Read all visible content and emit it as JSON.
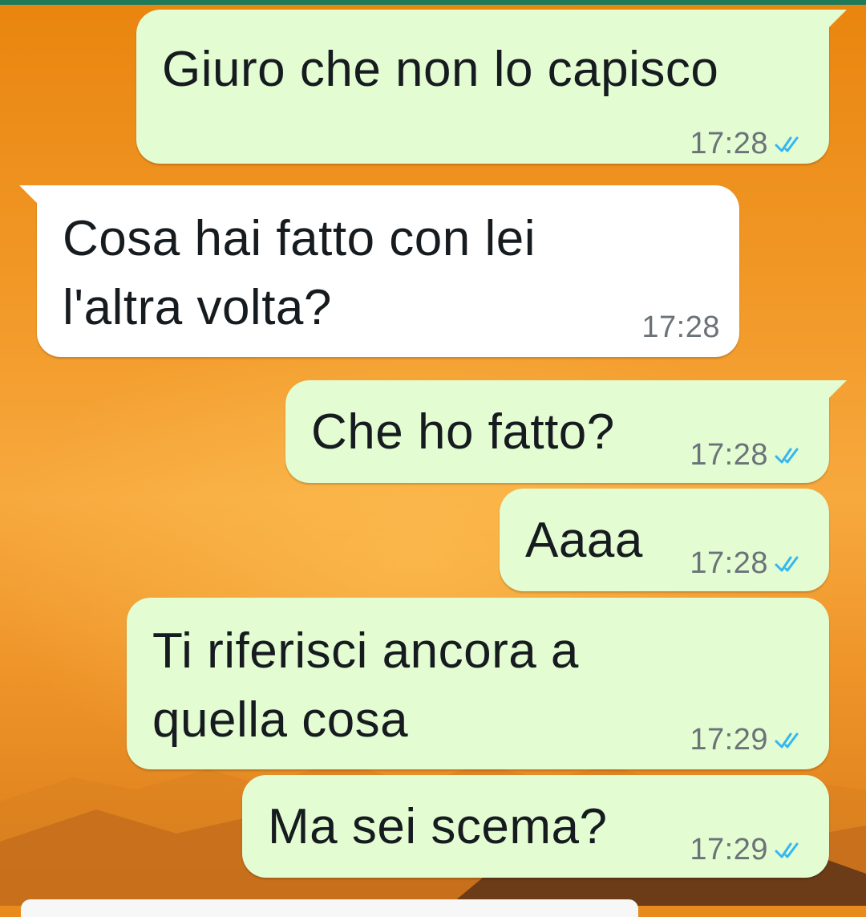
{
  "colors": {
    "outgoing_bubble": "#e3fcd2",
    "incoming_bubble": "#ffffff",
    "read_ticks": "#34b7f1",
    "wallpaper": "#e98a1c"
  },
  "icons": {
    "read_status": "double-check-icon"
  },
  "messages": [
    {
      "direction": "out",
      "text_lines": [
        "Giuro che non lo capisco"
      ],
      "time": "17:28",
      "read": true
    },
    {
      "direction": "in",
      "text_lines": [
        "Cosa hai fatto con lei",
        "l'altra volta?"
      ],
      "time": "17:28"
    },
    {
      "direction": "out",
      "text_lines": [
        "Che ho fatto?"
      ],
      "time": "17:28",
      "read": true
    },
    {
      "direction": "out",
      "text_lines": [
        "Aaaa"
      ],
      "time": "17:28",
      "read": true
    },
    {
      "direction": "out",
      "text_lines": [
        "Ti riferisci ancora a",
        "quella cosa"
      ],
      "time": "17:29",
      "read": true
    },
    {
      "direction": "out",
      "text_lines": [
        "Ma sei scema?"
      ],
      "time": "17:29",
      "read": true
    }
  ]
}
